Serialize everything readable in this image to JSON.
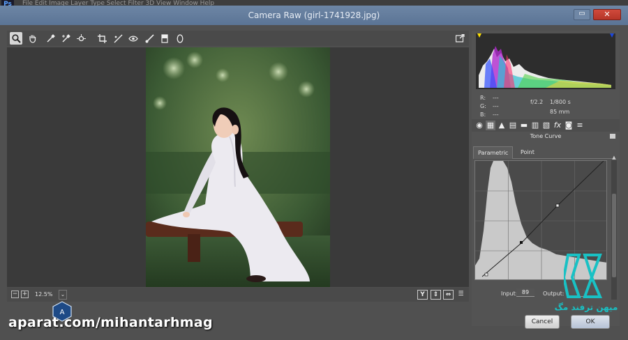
{
  "app": {
    "logo_text": "Ps",
    "menu_text": "File  Edit  Image  Layer  Type  Select  Filter  3D  View  Window  Help",
    "window_title": "Camera Raw (girl-1741928.jpg)",
    "close_label": "✕",
    "minimize_label": "▭"
  },
  "toolbar": {
    "tools": [
      {
        "name": "zoom-tool-icon",
        "glyph": "🔍",
        "active": true
      },
      {
        "name": "hand-tool-icon",
        "glyph": "✋"
      },
      {
        "name": "white-balance-tool-icon",
        "glyph": "✒"
      },
      {
        "name": "color-sampler-tool-icon",
        "glyph": "✒"
      },
      {
        "name": "targeted-adjustment-tool-icon",
        "glyph": "⊕"
      },
      {
        "name": "crop-tool-icon",
        "glyph": "⌗"
      },
      {
        "name": "spot-removal-tool-icon",
        "glyph": "✎"
      },
      {
        "name": "red-eye-tool-icon",
        "glyph": "👁"
      },
      {
        "name": "adjustment-brush-icon",
        "glyph": "✐"
      },
      {
        "name": "graduated-filter-icon",
        "glyph": "▮"
      },
      {
        "name": "radial-filter-icon",
        "glyph": "◯"
      }
    ],
    "open_glyph": "⇱"
  },
  "preview": {
    "zoom_level": "12.5%",
    "zoom_out": "−",
    "zoom_in": "+",
    "zoom_dropdown": "⌄",
    "view_buttons": [
      "Y",
      "⇕",
      "⇔",
      "☰"
    ]
  },
  "info": {
    "r_label": "R:",
    "g_label": "G:",
    "b_label": "B:",
    "r_val": "---",
    "g_val": "---",
    "b_val": "---",
    "aperture": "f/2.2",
    "shutter": "1/800 s",
    "focal": "85 mm"
  },
  "panel": {
    "tab_icons": [
      {
        "name": "basic-panel-icon",
        "glyph": "◉"
      },
      {
        "name": "tone-curve-panel-icon",
        "glyph": "▦"
      },
      {
        "name": "detail-panel-icon",
        "glyph": "▲"
      },
      {
        "name": "hsl-panel-icon",
        "glyph": "▤"
      },
      {
        "name": "split-toning-panel-icon",
        "glyph": "▬"
      },
      {
        "name": "lens-corrections-panel-icon",
        "glyph": "▥"
      },
      {
        "name": "transform-panel-icon",
        "glyph": "▧"
      },
      {
        "name": "effects-panel-icon",
        "glyph": "fx"
      },
      {
        "name": "camera-calibration-panel-icon",
        "glyph": "◙"
      },
      {
        "name": "presets-panel-icon",
        "glyph": "≡"
      }
    ],
    "title": "Tone Curve",
    "subtabs": [
      "Parametric",
      "Point"
    ],
    "input_label": "Input:",
    "input_value": "89",
    "output_label": "Output:",
    "output_value": ""
  },
  "buttons": {
    "cancel": "Cancel",
    "ok": "OK"
  },
  "watermarks": {
    "site": "aparat.com/mihantarhmag",
    "brand": "میهن ترفند مگ"
  },
  "colors": {
    "titlebar": "#6280a3",
    "accent": "#19c1c4"
  }
}
